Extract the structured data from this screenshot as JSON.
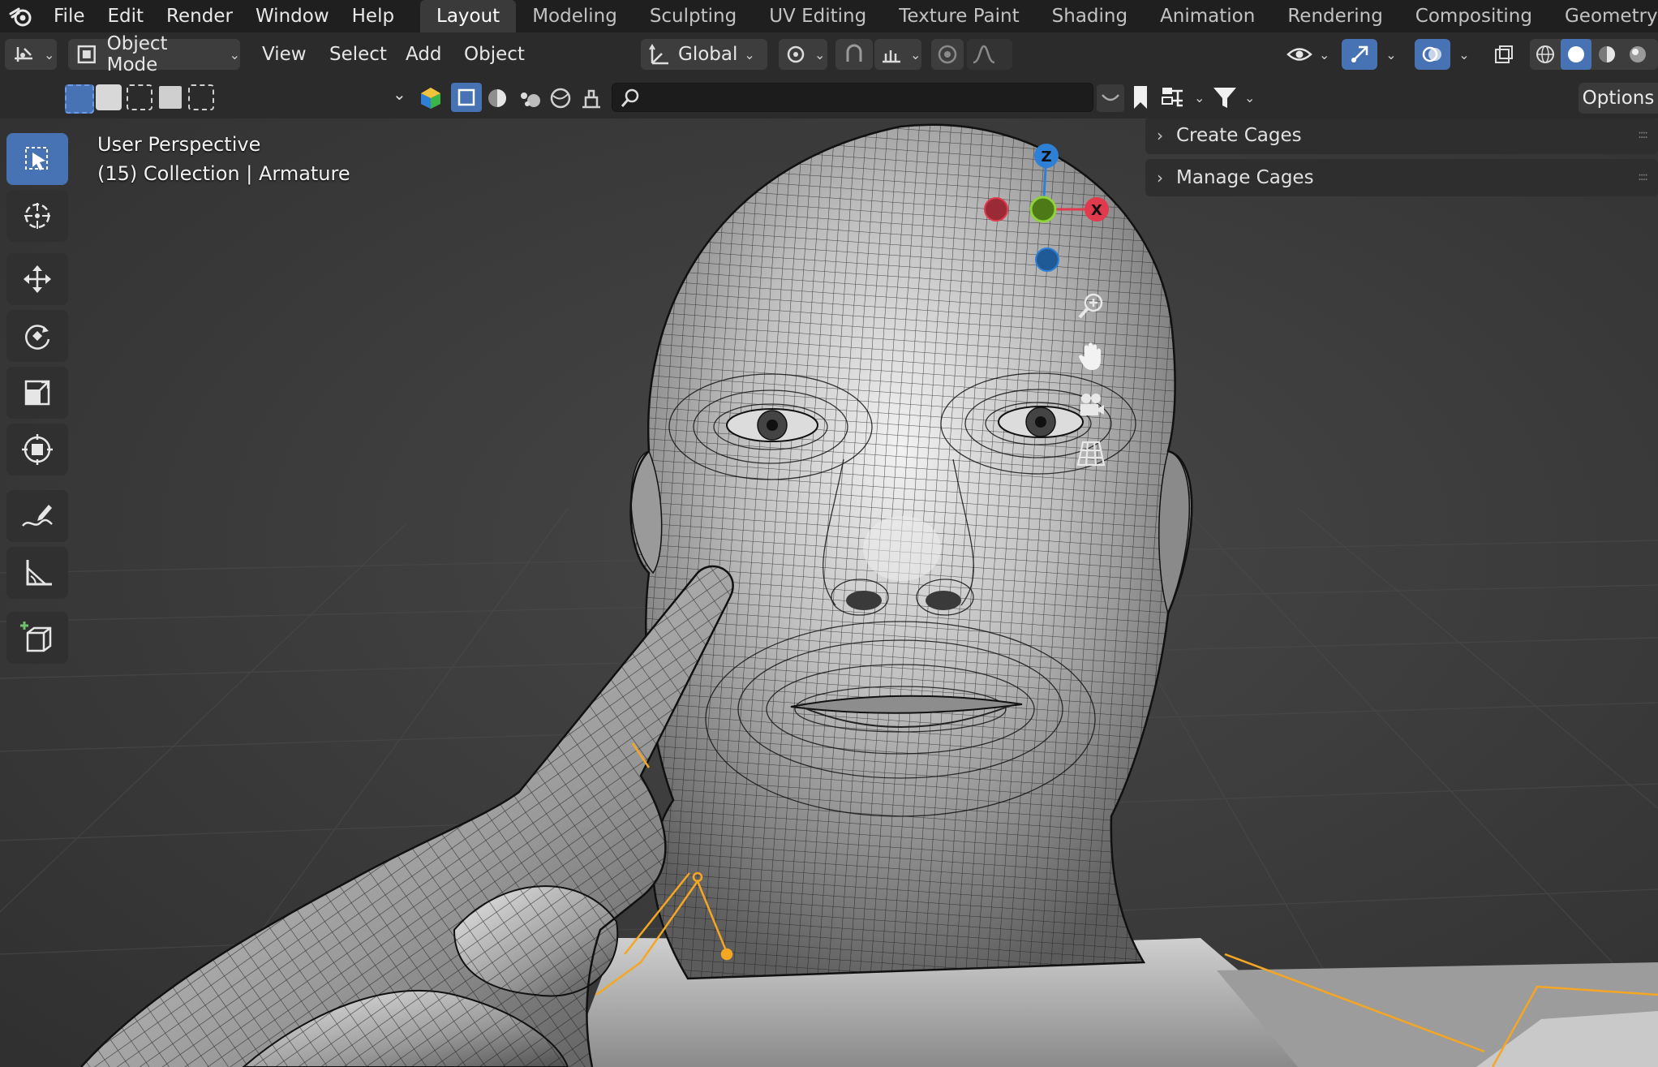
{
  "top_menu": {
    "items": [
      "File",
      "Edit",
      "Render",
      "Window",
      "Help"
    ]
  },
  "workspaces": {
    "tabs": [
      "Layout",
      "Modeling",
      "Sculpting",
      "UV Editing",
      "Texture Paint",
      "Shading",
      "Animation",
      "Rendering",
      "Compositing",
      "Geometry Nodes"
    ],
    "active": "Layout"
  },
  "header": {
    "mode_label": "Object Mode",
    "menus": [
      "View",
      "Select",
      "Add",
      "Object"
    ],
    "orientation_label": "Global"
  },
  "tool_settings": {
    "options_label": "Options",
    "search_value": ""
  },
  "viewport": {
    "view_name": "User Perspective",
    "collection_info": "(15) Collection | Armature"
  },
  "gizmo": {
    "z_label": "Z",
    "x_label": "X"
  },
  "sidebar": {
    "panels": [
      "Create Cages",
      "Manage Cages"
    ]
  },
  "colors": {
    "accent": "#4772b3",
    "armature": "#f5a623",
    "axis_x": "#e03a4c",
    "axis_y": "#6ea21d",
    "axis_z": "#2e7fd6"
  },
  "icons": [
    "blender-logo-icon",
    "editor-type-icon",
    "object-mode-icon",
    "transform-orientation-icon",
    "pivot-icon",
    "snap-icon",
    "snap-increment-icon",
    "proportional-edit-icon",
    "falloff-icon",
    "visibility-icon",
    "gizmo-icon",
    "overlay-icon",
    "xray-icon",
    "wireframe-shading-icon",
    "solid-shading-icon",
    "material-shading-icon",
    "rendered-shading-icon",
    "select-tool-icon",
    "cursor-tool-icon",
    "move-tool-icon",
    "rotate-tool-icon",
    "scale-tool-icon",
    "transform-tool-icon",
    "annotate-tool-icon",
    "measure-tool-icon",
    "add-cube-tool-icon",
    "zoom-icon",
    "pan-hand-icon",
    "camera-icon",
    "grid-icon",
    "search-icon",
    "bookmark-icon",
    "filter-icon"
  ]
}
